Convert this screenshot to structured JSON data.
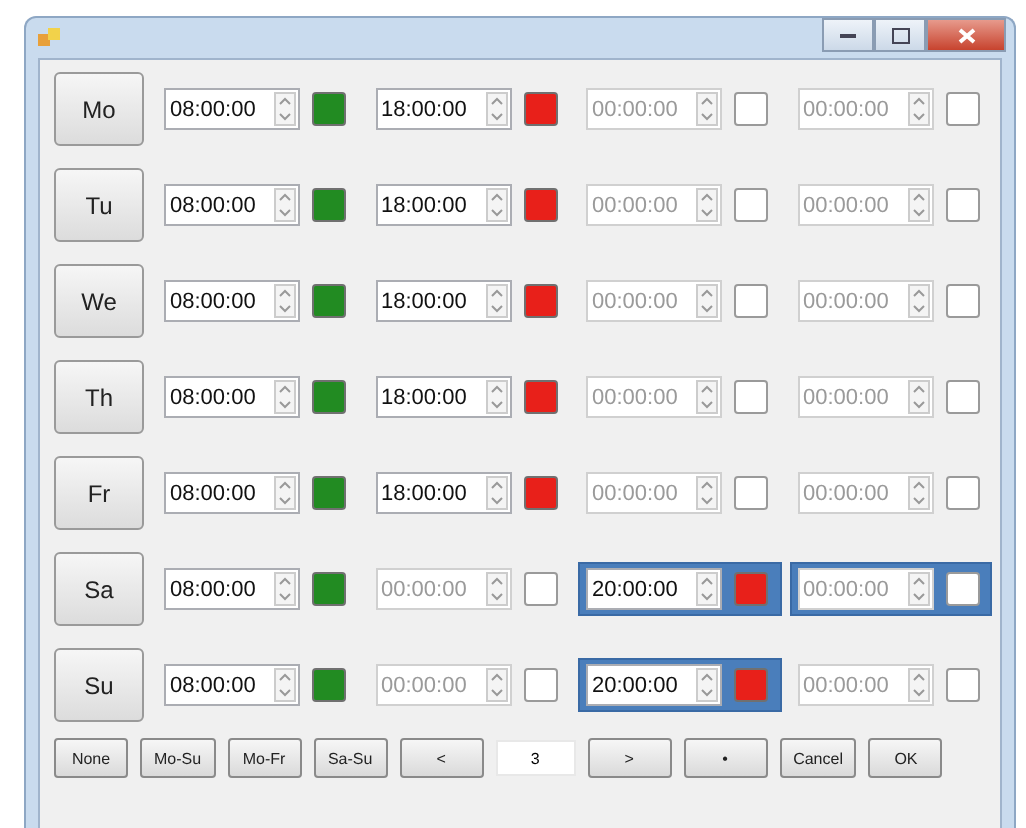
{
  "days": [
    {
      "label": "Mo",
      "slots": [
        {
          "time": "08:00:00",
          "active": true,
          "color": "#228b22",
          "selected": false
        },
        {
          "time": "18:00:00",
          "active": true,
          "color": "#e8201a",
          "selected": false
        },
        {
          "time": "00:00:00",
          "active": false,
          "selected": false
        },
        {
          "time": "00:00:00",
          "active": false,
          "selected": false
        }
      ]
    },
    {
      "label": "Tu",
      "slots": [
        {
          "time": "08:00:00",
          "active": true,
          "color": "#228b22",
          "selected": false
        },
        {
          "time": "18:00:00",
          "active": true,
          "color": "#e8201a",
          "selected": false
        },
        {
          "time": "00:00:00",
          "active": false,
          "selected": false
        },
        {
          "time": "00:00:00",
          "active": false,
          "selected": false
        }
      ]
    },
    {
      "label": "We",
      "slots": [
        {
          "time": "08:00:00",
          "active": true,
          "color": "#228b22",
          "selected": false
        },
        {
          "time": "18:00:00",
          "active": true,
          "color": "#e8201a",
          "selected": false
        },
        {
          "time": "00:00:00",
          "active": false,
          "selected": false
        },
        {
          "time": "00:00:00",
          "active": false,
          "selected": false
        }
      ]
    },
    {
      "label": "Th",
      "slots": [
        {
          "time": "08:00:00",
          "active": true,
          "color": "#228b22",
          "selected": false
        },
        {
          "time": "18:00:00",
          "active": true,
          "color": "#e8201a",
          "selected": false
        },
        {
          "time": "00:00:00",
          "active": false,
          "selected": false
        },
        {
          "time": "00:00:00",
          "active": false,
          "selected": false
        }
      ]
    },
    {
      "label": "Fr",
      "slots": [
        {
          "time": "08:00:00",
          "active": true,
          "color": "#228b22",
          "selected": false
        },
        {
          "time": "18:00:00",
          "active": true,
          "color": "#e8201a",
          "selected": false
        },
        {
          "time": "00:00:00",
          "active": false,
          "selected": false
        },
        {
          "time": "00:00:00",
          "active": false,
          "selected": false
        }
      ]
    },
    {
      "label": "Sa",
      "slots": [
        {
          "time": "08:00:00",
          "active": true,
          "color": "#228b22",
          "selected": false
        },
        {
          "time": "00:00:00",
          "active": false,
          "selected": false
        },
        {
          "time": "20:00:00",
          "active": true,
          "color": "#e8201a",
          "selected": true
        },
        {
          "time": "00:00:00",
          "active": false,
          "selected": true
        }
      ]
    },
    {
      "label": "Su",
      "slots": [
        {
          "time": "08:00:00",
          "active": true,
          "color": "#228b22",
          "selected": false
        },
        {
          "time": "00:00:00",
          "active": false,
          "selected": false
        },
        {
          "time": "20:00:00",
          "active": true,
          "color": "#e8201a",
          "selected": true
        },
        {
          "time": "00:00:00",
          "active": false,
          "selected": false
        }
      ]
    }
  ],
  "bottom": [
    {
      "kind": "button",
      "label": "None"
    },
    {
      "kind": "button",
      "label": "Mo-Su"
    },
    {
      "kind": "button",
      "label": "Mo-Fr"
    },
    {
      "kind": "button",
      "label": "Sa-Su"
    },
    {
      "kind": "button",
      "label": "<"
    },
    {
      "kind": "field",
      "value": "3"
    },
    {
      "kind": "button",
      "label": ">"
    },
    {
      "kind": "button",
      "label": "•"
    },
    {
      "kind": "button",
      "label": "Cancel"
    },
    {
      "kind": "button",
      "label": "OK"
    }
  ]
}
